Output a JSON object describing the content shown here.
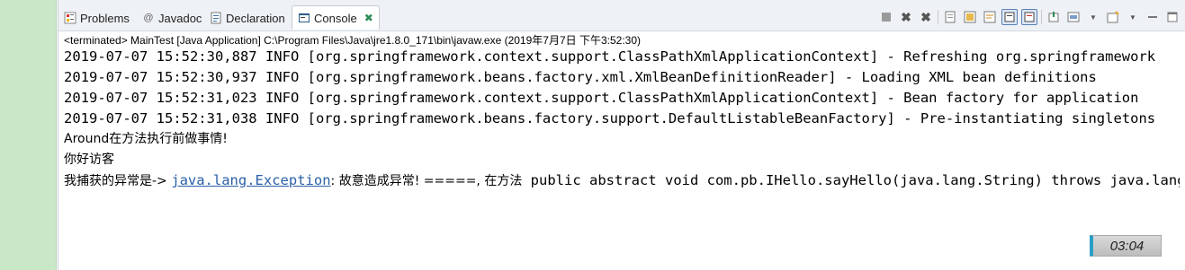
{
  "tabs": [
    {
      "label": "Problems",
      "icon": "problems-icon"
    },
    {
      "label": "Javadoc",
      "icon": "javadoc-icon"
    },
    {
      "label": "Declaration",
      "icon": "declaration-icon"
    },
    {
      "label": "Console",
      "icon": "console-icon",
      "active": true
    }
  ],
  "status": "<terminated> MainTest [Java Application] C:\\Program Files\\Java\\jre1.8.0_171\\bin\\javaw.exe (2019年7月7日 下午3:52:30)",
  "console_lines": [
    "2019-07-07 15:52:30,887 INFO [org.springframework.context.support.ClassPathXmlApplicationContext] - Refreshing org.springframework",
    "2019-07-07 15:52:30,937 INFO [org.springframework.beans.factory.xml.XmlBeanDefinitionReader] - Loading XML bean definitions",
    "2019-07-07 15:52:31,023 INFO [org.springframework.context.support.ClassPathXmlApplicationContext] - Bean factory for application",
    "2019-07-07 15:52:31,038 INFO [org.springframework.beans.factory.support.DefaultListableBeanFactory] - Pre-instantiating singletons",
    "Around在方法执行前做事情!",
    "你好访客"
  ],
  "exception_line": {
    "prefix": "我捕获的异常是-> ",
    "link": "java.lang.Exception",
    "middle": ": 故意造成异常! =====, 在方法",
    "suffix": " public abstract void com.pb.IHello.sayHello(java.lang.String) throws java.lang.Exception"
  },
  "clock": "03:04",
  "colors": {
    "link": "#2a5fa8",
    "tab_close": "#2e8b57",
    "left_strip": "#c8e8c8"
  }
}
